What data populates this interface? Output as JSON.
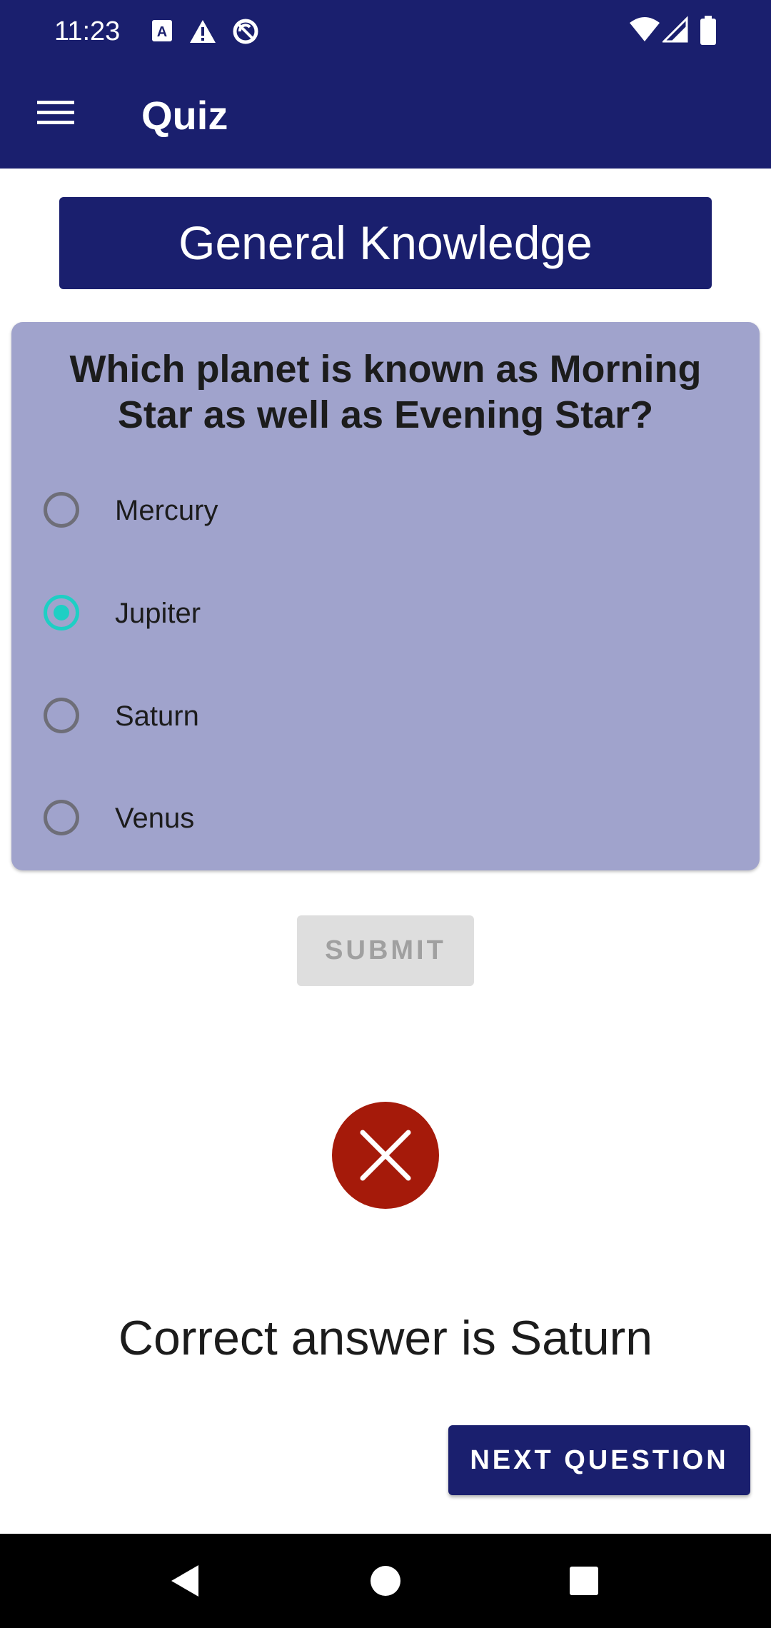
{
  "status_bar": {
    "time": "11:23",
    "left_icons": [
      "text-a-icon",
      "alert-triangle-icon",
      "block-sync-icon"
    ],
    "right_icons": [
      "wifi-icon",
      "signal-icon",
      "battery-icon"
    ]
  },
  "app_bar": {
    "title": "Quiz",
    "menu_icon": "hamburger-menu-icon"
  },
  "category": {
    "title": "General Knowledge"
  },
  "question": {
    "text": "Which planet is known as Morning Star as well as Evening Star?",
    "options": [
      {
        "label": "Mercury",
        "selected": false
      },
      {
        "label": "Jupiter",
        "selected": true
      },
      {
        "label": "Saturn",
        "selected": false
      },
      {
        "label": "Venus",
        "selected": false
      }
    ]
  },
  "submit": {
    "label": "SUBMIT",
    "enabled": false
  },
  "result": {
    "icon": "wrong-cross-icon",
    "text": "Correct answer is Saturn"
  },
  "next": {
    "label": "NEXT QUESTION"
  },
  "nav_bar": {
    "icons": [
      "back-icon",
      "home-icon",
      "recents-icon"
    ]
  },
  "colors": {
    "primary": "#1a1f6e",
    "card": "#a0a3cc",
    "accent": "#1ecfc4",
    "error": "#a51a0a",
    "disabled_bg": "#dedede",
    "disabled_text": "#a0a0a0"
  }
}
